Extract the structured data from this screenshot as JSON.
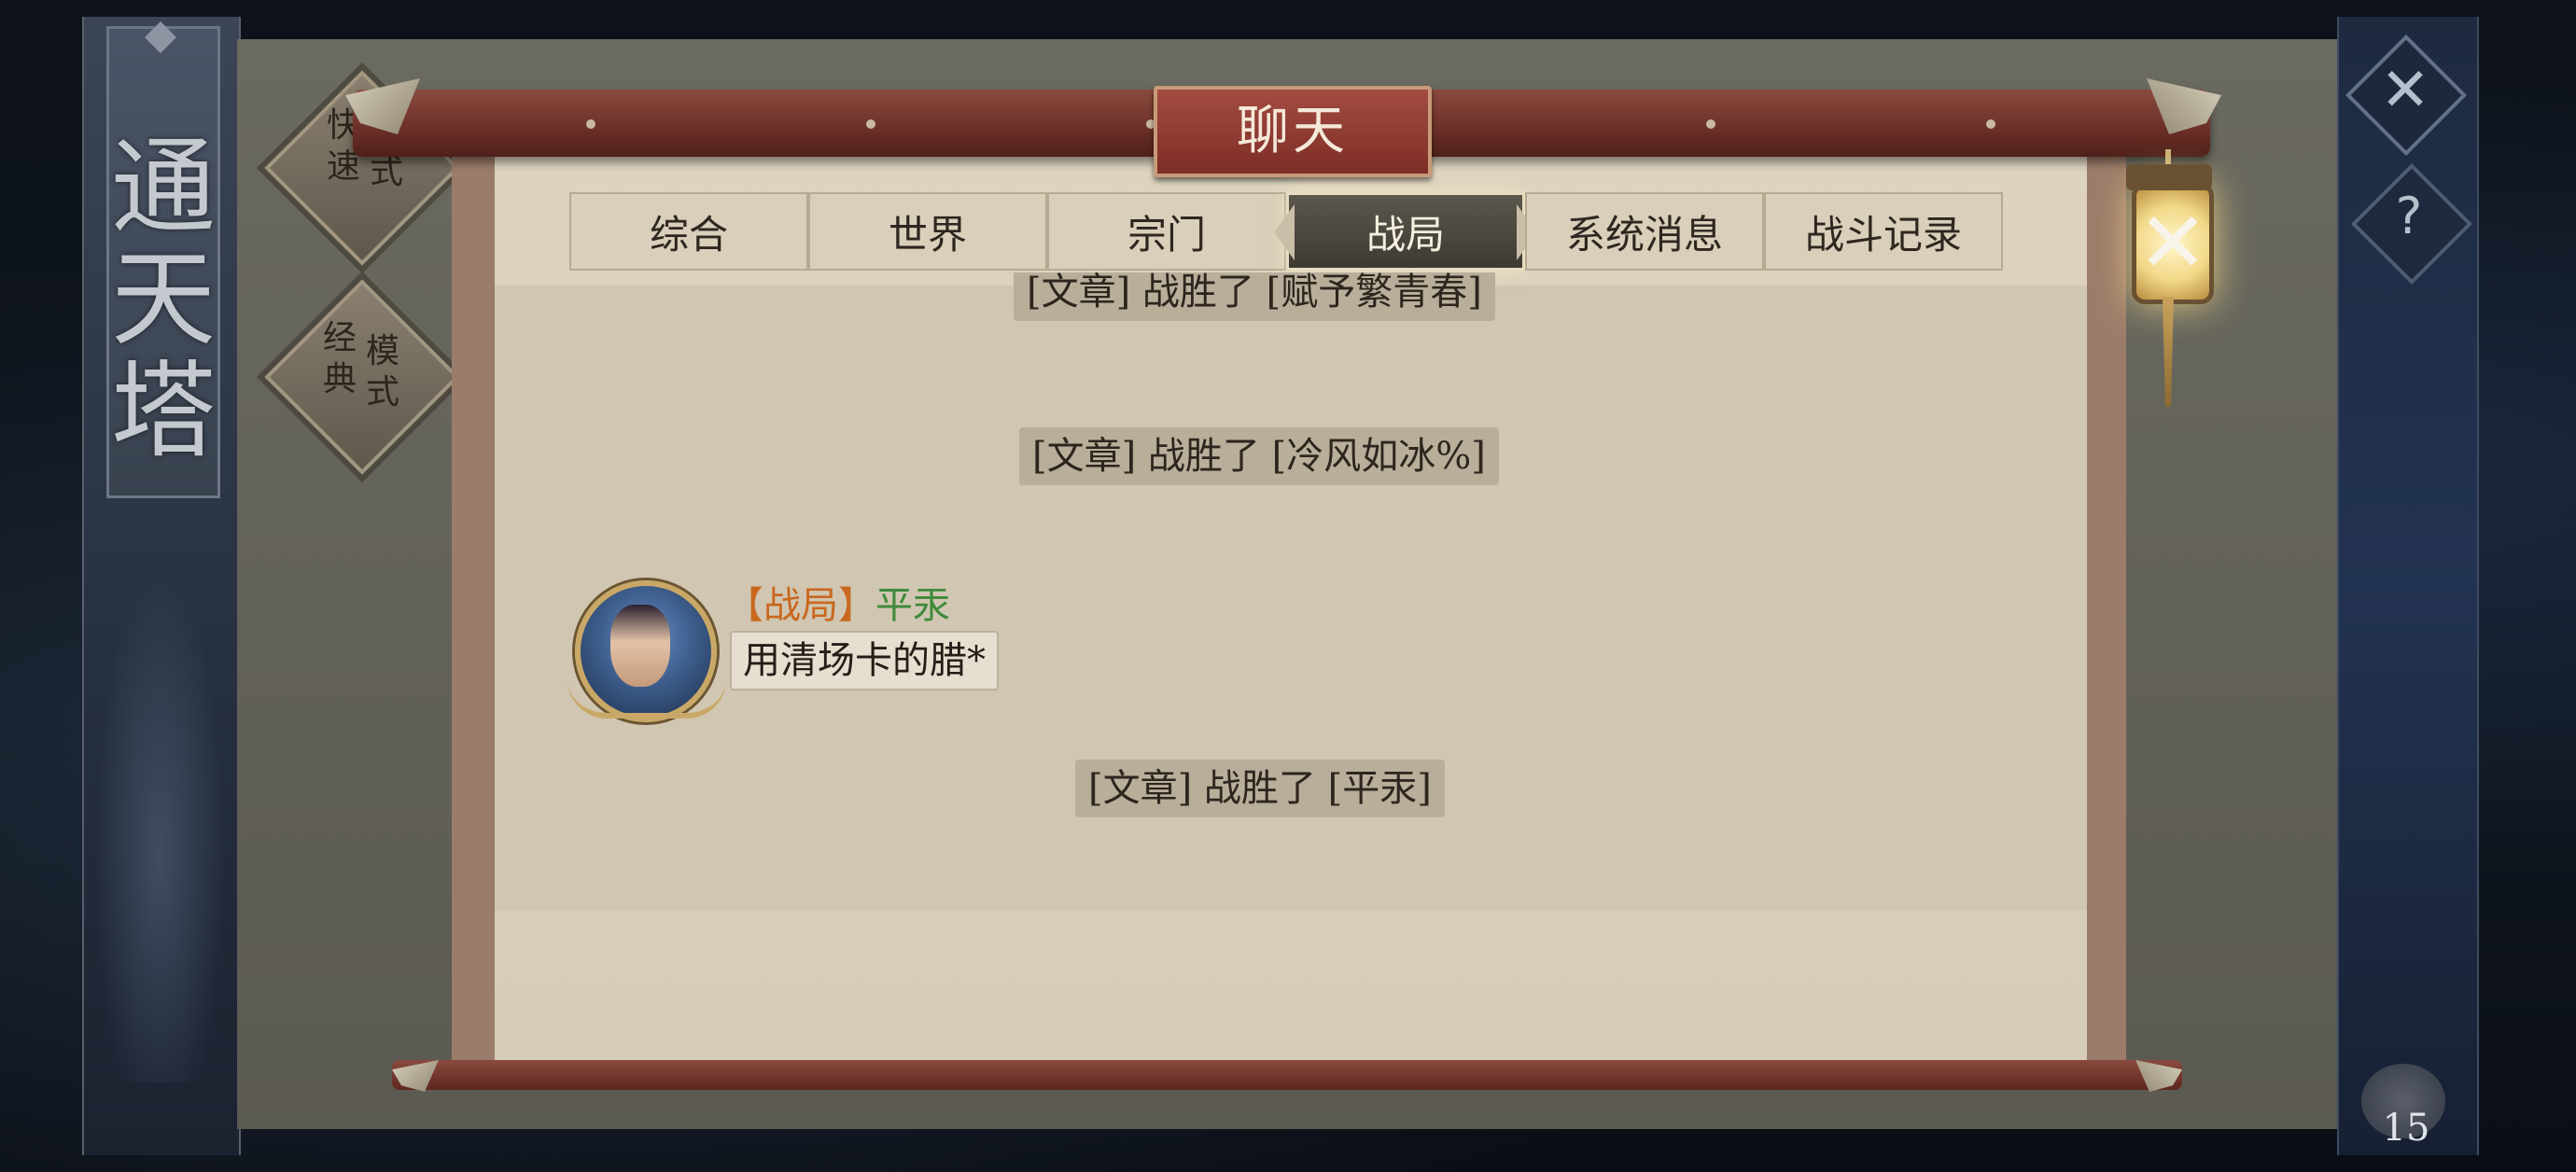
{
  "left_banner": {
    "chars": [
      "通",
      "天",
      "塔"
    ]
  },
  "modes": {
    "quick": {
      "line1": "快",
      "line2": "速",
      "line3": "式"
    },
    "classic": {
      "line1": "经",
      "line2": "典",
      "line3": "模",
      "line4": "式"
    }
  },
  "window": {
    "title": "聊天"
  },
  "tabs": [
    {
      "label": "综合",
      "active": false
    },
    {
      "label": "世界",
      "active": false
    },
    {
      "label": "宗门",
      "active": false
    },
    {
      "label": "战局",
      "active": true
    },
    {
      "label": "系统消息",
      "active": false
    },
    {
      "label": "战斗记录",
      "active": false
    }
  ],
  "messages": {
    "partial_system": "[文章] 战胜了 [赋予繁青春]",
    "system1": "[文章] 战胜了 [冷风如冰%]",
    "chat": {
      "channel_tag": "【战局】",
      "sender": "平汞",
      "text": "用清场卡的腊*"
    },
    "system2": "[文章] 战胜了 [平汞]"
  },
  "right_panel": {
    "close_glyph": "✕",
    "help_glyph": "?",
    "counter": "15"
  },
  "lantern": {
    "close_glyph": "✕"
  },
  "colors": {
    "channel_tag": "#c9681f",
    "sender_name": "#3f8a3a",
    "rod": "#6e3129"
  }
}
